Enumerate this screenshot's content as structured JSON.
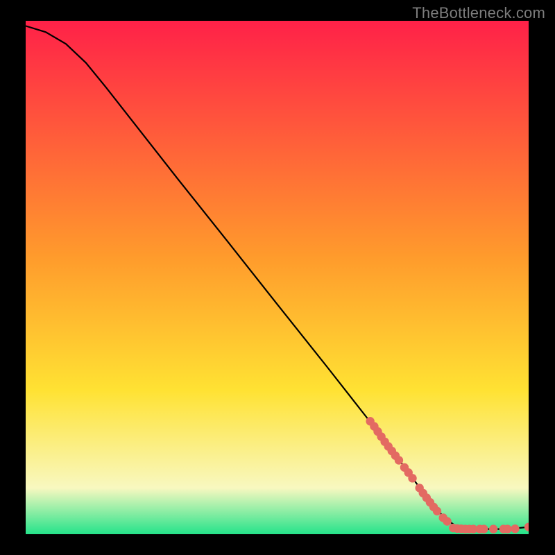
{
  "attribution": "TheBottleneck.com",
  "colors": {
    "gradient_top": "#ff2148",
    "gradient_mid_orange": "#ff9b2c",
    "gradient_yellow": "#ffe233",
    "gradient_pale": "#f8f8c0",
    "gradient_green": "#25e38a",
    "curve": "#000000",
    "dot": "#e36a62",
    "bg": "#000000"
  },
  "chart_data": {
    "type": "line",
    "xlabel": "",
    "ylabel": "",
    "xlim": [
      0,
      100
    ],
    "ylim": [
      0,
      100
    ],
    "curve": {
      "name": "bottleneck-curve",
      "points": [
        {
          "x": 0.0,
          "y": 99.0
        },
        {
          "x": 4.0,
          "y": 97.8
        },
        {
          "x": 8.0,
          "y": 95.5
        },
        {
          "x": 12.0,
          "y": 91.8
        },
        {
          "x": 16.0,
          "y": 87.0
        },
        {
          "x": 22.0,
          "y": 79.5
        },
        {
          "x": 30.0,
          "y": 69.5
        },
        {
          "x": 40.0,
          "y": 57.2
        },
        {
          "x": 50.0,
          "y": 44.8
        },
        {
          "x": 60.0,
          "y": 32.5
        },
        {
          "x": 68.0,
          "y": 22.5
        },
        {
          "x": 74.0,
          "y": 14.8
        },
        {
          "x": 78.0,
          "y": 9.5
        },
        {
          "x": 81.0,
          "y": 5.6
        },
        {
          "x": 83.5,
          "y": 3.0
        },
        {
          "x": 85.5,
          "y": 1.6
        },
        {
          "x": 88.0,
          "y": 1.0
        },
        {
          "x": 92.0,
          "y": 1.0
        },
        {
          "x": 96.0,
          "y": 1.0
        },
        {
          "x": 100.0,
          "y": 1.4
        }
      ]
    },
    "dots": {
      "name": "samples",
      "points": [
        {
          "x": 68.5,
          "y": 22.0
        },
        {
          "x": 69.3,
          "y": 21.0
        },
        {
          "x": 70.0,
          "y": 20.0
        },
        {
          "x": 70.7,
          "y": 19.0
        },
        {
          "x": 71.4,
          "y": 18.0
        },
        {
          "x": 72.1,
          "y": 17.1
        },
        {
          "x": 72.8,
          "y": 16.2
        },
        {
          "x": 73.5,
          "y": 15.3
        },
        {
          "x": 74.2,
          "y": 14.4
        },
        {
          "x": 75.3,
          "y": 13.0
        },
        {
          "x": 76.1,
          "y": 12.0
        },
        {
          "x": 76.9,
          "y": 10.9
        },
        {
          "x": 78.3,
          "y": 9.0
        },
        {
          "x": 79.0,
          "y": 8.0
        },
        {
          "x": 79.7,
          "y": 7.1
        },
        {
          "x": 80.4,
          "y": 6.2
        },
        {
          "x": 81.1,
          "y": 5.3
        },
        {
          "x": 81.8,
          "y": 4.5
        },
        {
          "x": 83.0,
          "y": 3.2
        },
        {
          "x": 83.8,
          "y": 2.5
        },
        {
          "x": 85.0,
          "y": 1.2
        },
        {
          "x": 85.8,
          "y": 1.1
        },
        {
          "x": 86.6,
          "y": 1.05
        },
        {
          "x": 87.4,
          "y": 1.0
        },
        {
          "x": 88.2,
          "y": 1.0
        },
        {
          "x": 89.0,
          "y": 1.0
        },
        {
          "x": 90.3,
          "y": 1.0
        },
        {
          "x": 91.1,
          "y": 1.0
        },
        {
          "x": 93.0,
          "y": 1.0
        },
        {
          "x": 95.0,
          "y": 1.0
        },
        {
          "x": 95.8,
          "y": 1.0
        },
        {
          "x": 97.3,
          "y": 1.05
        },
        {
          "x": 100.0,
          "y": 1.4
        }
      ]
    }
  }
}
